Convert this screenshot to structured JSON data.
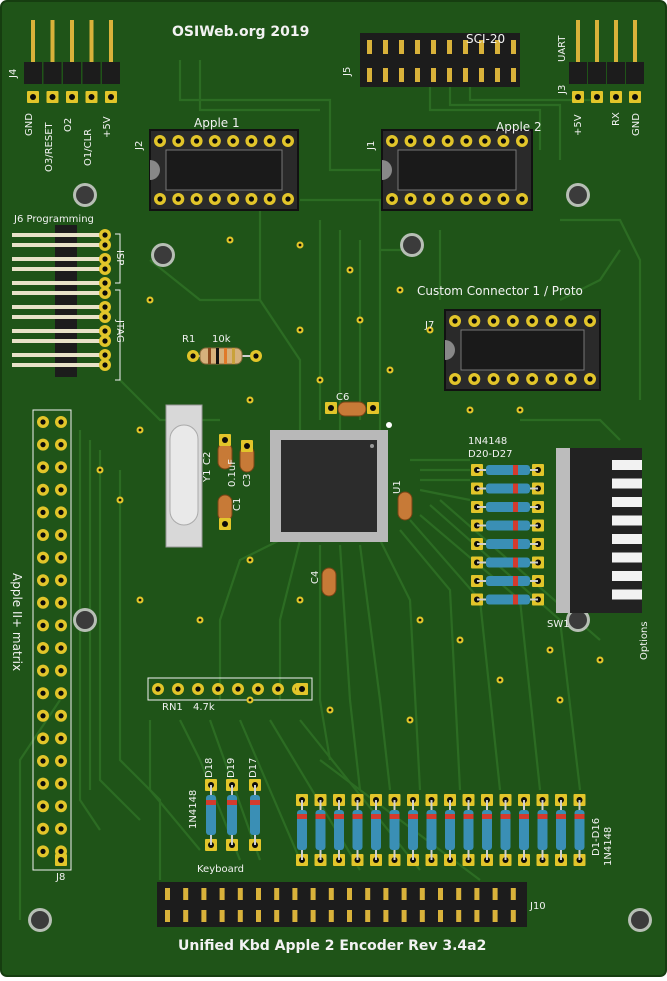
{
  "board": {
    "header_title": "OSIWeb.org 2019",
    "footer_title": "Unified Kbd Apple 2 Encoder Rev 3.4a2",
    "colors": {
      "pcb": "#1f5418",
      "pcb_dark": "#173f12",
      "trace": "#2d6c23",
      "silk": "#f2f2f2",
      "pad": "#e2c52a",
      "header_black": "#1c1c1c",
      "pin_gold": "#d9b23a"
    }
  },
  "connectors": {
    "j4": {
      "ref": "J4",
      "pins": [
        "GND",
        "O3/RESET",
        "O2",
        "O1/CLR",
        "+5V"
      ]
    },
    "j5": {
      "ref": "J5",
      "name": "SCI-20"
    },
    "j3": {
      "ref": "J3",
      "name": "UART",
      "pins": [
        "+5V",
        "RX",
        "GND"
      ]
    },
    "j2": {
      "ref": "J2",
      "name": "Apple 1"
    },
    "j1": {
      "ref": "J1",
      "name": "Apple 2"
    },
    "j6": {
      "ref": "J6",
      "name": "J6 Programming",
      "groups": [
        "ISP",
        "JTAG"
      ]
    },
    "j7": {
      "ref": "J7",
      "name": "Custom Connector 1 / Proto"
    },
    "j8": {
      "ref": "J8",
      "name": "Apple II+ matrix"
    },
    "j10": {
      "ref": "J10",
      "name": "Keyboard"
    }
  },
  "components": {
    "r1": {
      "ref": "R1",
      "value": "10k"
    },
    "c6": {
      "ref": "C6"
    },
    "y1": {
      "ref": "Y1"
    },
    "c2": {
      "ref": "C2",
      "value": "0.1uF"
    },
    "c1": {
      "ref": "C1"
    },
    "c3": {
      "ref": "C3"
    },
    "c4": {
      "ref": "C4"
    },
    "u1": {
      "ref": "U1"
    },
    "rn1": {
      "ref": "RN1",
      "value": "4.7k"
    },
    "sw1": {
      "ref": "SW1",
      "name": "Options"
    },
    "diodes_top": {
      "part": "1N4148",
      "refs": "D20-D27"
    },
    "diodes_left": {
      "part": "1N4148",
      "refs": [
        "D18",
        "D19",
        "D17"
      ]
    },
    "diodes_bottom": {
      "part": "1N4148",
      "refs": "D1-D16"
    }
  }
}
